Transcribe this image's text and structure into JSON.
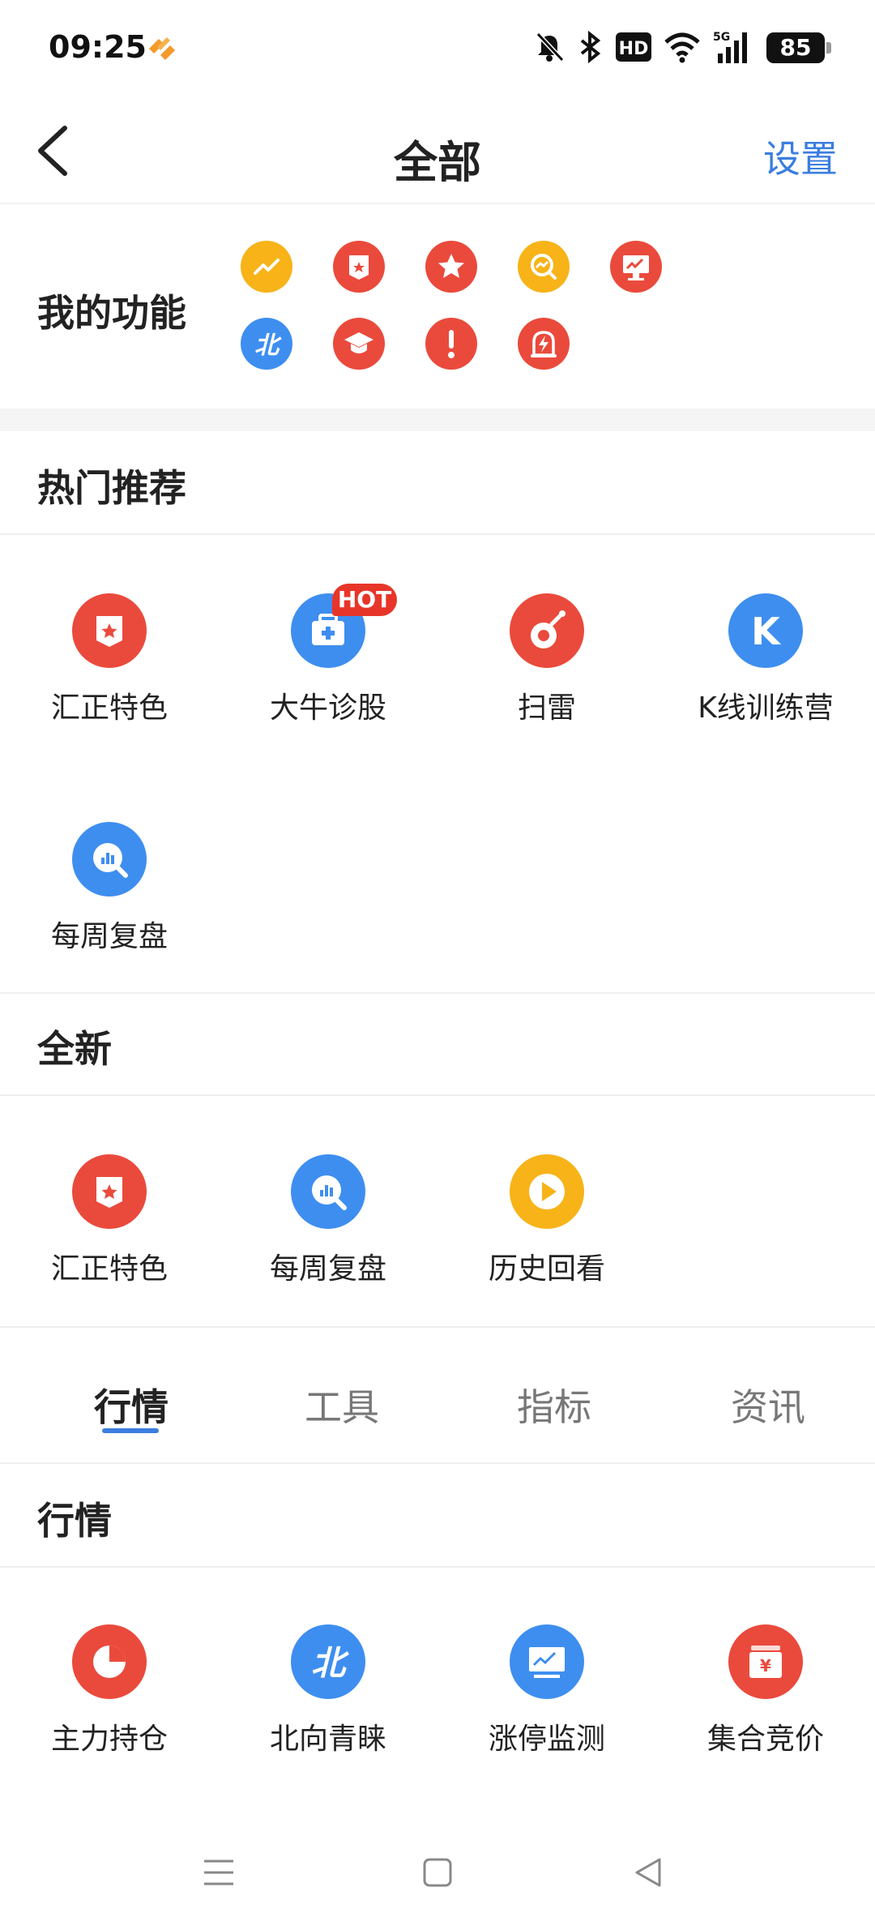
{
  "status": {
    "time": "09:25",
    "battery": "85",
    "hd": "HD",
    "network": "5G"
  },
  "nav": {
    "title": "全部",
    "settings": "设置"
  },
  "my_functions": {
    "label": "我的功能",
    "icons": [
      {
        "name": "trend-icon",
        "color": "#f7b318"
      },
      {
        "name": "red-badge-icon",
        "color": "#ea4a3c"
      },
      {
        "name": "star-icon",
        "color": "#ea4a3c"
      },
      {
        "name": "chart-search-icon",
        "color": "#f7b318"
      },
      {
        "name": "screen-chart-icon",
        "color": "#ea4a3c"
      },
      {
        "name": "north-icon",
        "color": "#3e8ef0"
      },
      {
        "name": "graduate-icon",
        "color": "#ea4a3c"
      },
      {
        "name": "alert-icon",
        "color": "#ea4a3c"
      },
      {
        "name": "lightning-icon",
        "color": "#ea4a3c"
      }
    ]
  },
  "hot": {
    "title": "热门推荐",
    "hot_badge": "HOT",
    "items": [
      {
        "label": "汇正特色"
      },
      {
        "label": "大牛诊股"
      },
      {
        "label": "扫雷"
      },
      {
        "label": "K线训练营"
      },
      {
        "label": "每周复盘"
      }
    ]
  },
  "new": {
    "title": "全新",
    "items": [
      {
        "label": "汇正特色"
      },
      {
        "label": "每周复盘"
      },
      {
        "label": "历史回看"
      }
    ]
  },
  "tabs": [
    {
      "label": "行情"
    },
    {
      "label": "工具"
    },
    {
      "label": "指标"
    },
    {
      "label": "资讯"
    }
  ],
  "market": {
    "title": "行情",
    "items": [
      {
        "label": "主力持仓"
      },
      {
        "label": "北向青睐"
      },
      {
        "label": "涨停监测"
      },
      {
        "label": "集合竞价"
      }
    ]
  },
  "colors": {
    "accent": "#3b7ee0",
    "red": "#ea4a3c",
    "blue": "#3e8ef0",
    "yellow": "#f7b318"
  }
}
